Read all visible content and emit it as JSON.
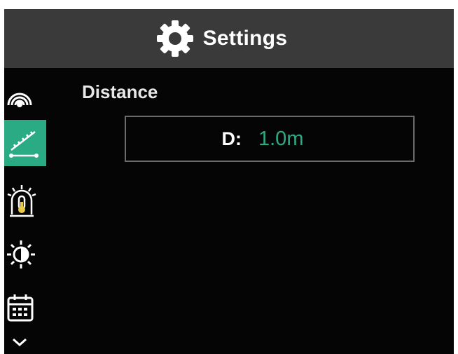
{
  "header": {
    "title": "Settings",
    "icon": "gear-icon"
  },
  "sidebar": {
    "items": [
      {
        "name": "emissivity",
        "icon": "signal-arcs-icon",
        "active": false
      },
      {
        "name": "distance",
        "icon": "ruler-distance-icon",
        "active": true
      },
      {
        "name": "alarm",
        "icon": "thermometer-alarm-icon",
        "active": false
      },
      {
        "name": "brightness",
        "icon": "brightness-sun-icon",
        "active": false
      },
      {
        "name": "date",
        "icon": "calendar-icon",
        "active": false
      }
    ],
    "more": "chevron-down-icon"
  },
  "content": {
    "section_title": "Distance",
    "field_label": "D:",
    "field_value": "1.0m"
  },
  "colors": {
    "accent": "#2bab84",
    "header_bg": "#3a3a3a",
    "screen_bg": "#050505"
  }
}
